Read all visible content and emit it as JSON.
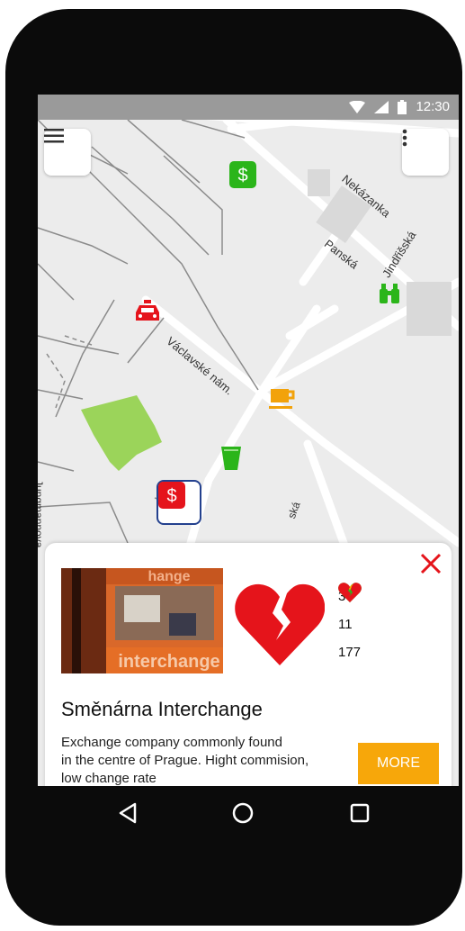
{
  "status": {
    "time": "12:30"
  },
  "streets": {
    "nekazanka": "Nekázanka",
    "jindrisska": "Jindřišská",
    "panska": "Panská",
    "vaclavske": "Václavské nám.",
    "jungmannova": "Jungmannova",
    "ska": "ská"
  },
  "markers": [
    "exchange-green",
    "taxi",
    "binoculars",
    "coffee",
    "drink",
    "exchange-red-selected"
  ],
  "card": {
    "name": "Směnárna Interchange",
    "description_lines": [
      "Exchange company commonly found",
      "in the centre of Prague. Hight commision,",
      "low change rate"
    ],
    "more_label": "MORE",
    "likes": "3",
    "neutral": "11",
    "dislikes": "177",
    "photo_text": "interchange"
  },
  "colors": {
    "accent": "#f7a70a",
    "like": "#2bb51a",
    "neutral": "#f2b705",
    "dislike": "#e5141b",
    "park": "#9bd45a"
  }
}
